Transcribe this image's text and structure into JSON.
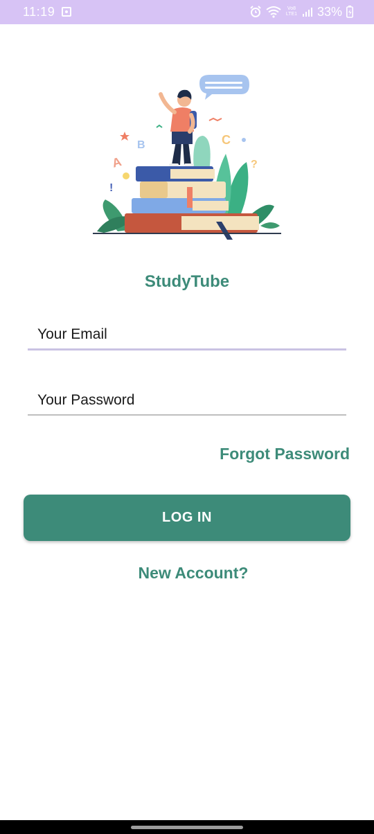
{
  "status_bar": {
    "time": "11:19",
    "battery": "33%",
    "network_label": "Vo8 LTE1",
    "icons": [
      "notification-icon",
      "alarm-icon",
      "wifi-icon",
      "signal-icon",
      "battery-charging-icon"
    ],
    "background": "#d7c3f5"
  },
  "app": {
    "title": "StudyTube",
    "accent": "#3d8b79"
  },
  "form": {
    "email_placeholder": "Your Email",
    "email_value": "",
    "password_placeholder": "Your Password",
    "password_value": "",
    "forgot_label": "Forgot Password",
    "login_label": "LOG IN",
    "new_account_label": "New Account?"
  }
}
